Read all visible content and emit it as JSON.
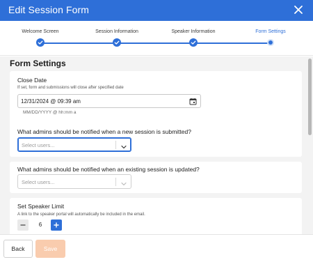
{
  "header": {
    "title": "Edit Session Form",
    "close_icon": "close-icon"
  },
  "stepper": {
    "steps": [
      {
        "label": "Welcome Screen",
        "state": "complete"
      },
      {
        "label": "Session Information",
        "state": "complete"
      },
      {
        "label": "Speaker Information",
        "state": "complete"
      },
      {
        "label": "Form Settings",
        "state": "current"
      }
    ],
    "accent": "#2e6fd8"
  },
  "main": {
    "section_title": "Form Settings",
    "close_date": {
      "title": "Close Date",
      "subtitle": "If set, form and submissions will close after specified date",
      "value": "12/31/2024 @ 09:39 am",
      "hint": "MM/DD/YYYY @ hh:mm a"
    },
    "notify_new": {
      "title": "What admins should be notified when a new session is submitted?",
      "placeholder": "Select users..."
    },
    "notify_update": {
      "title": "What admins should be notified when an existing session is updated?",
      "placeholder": "Select users..."
    },
    "speaker_limit": {
      "title": "Set Speaker Limit",
      "subtitle": "A link to the speaker portal will automatically be included in the email.",
      "value": "6"
    }
  },
  "footer": {
    "back_label": "Back",
    "save_label": "Save"
  },
  "colors": {
    "header": "#2e6fd8",
    "save_disabled": "#f9ccae",
    "background": "#f3f3f3"
  }
}
